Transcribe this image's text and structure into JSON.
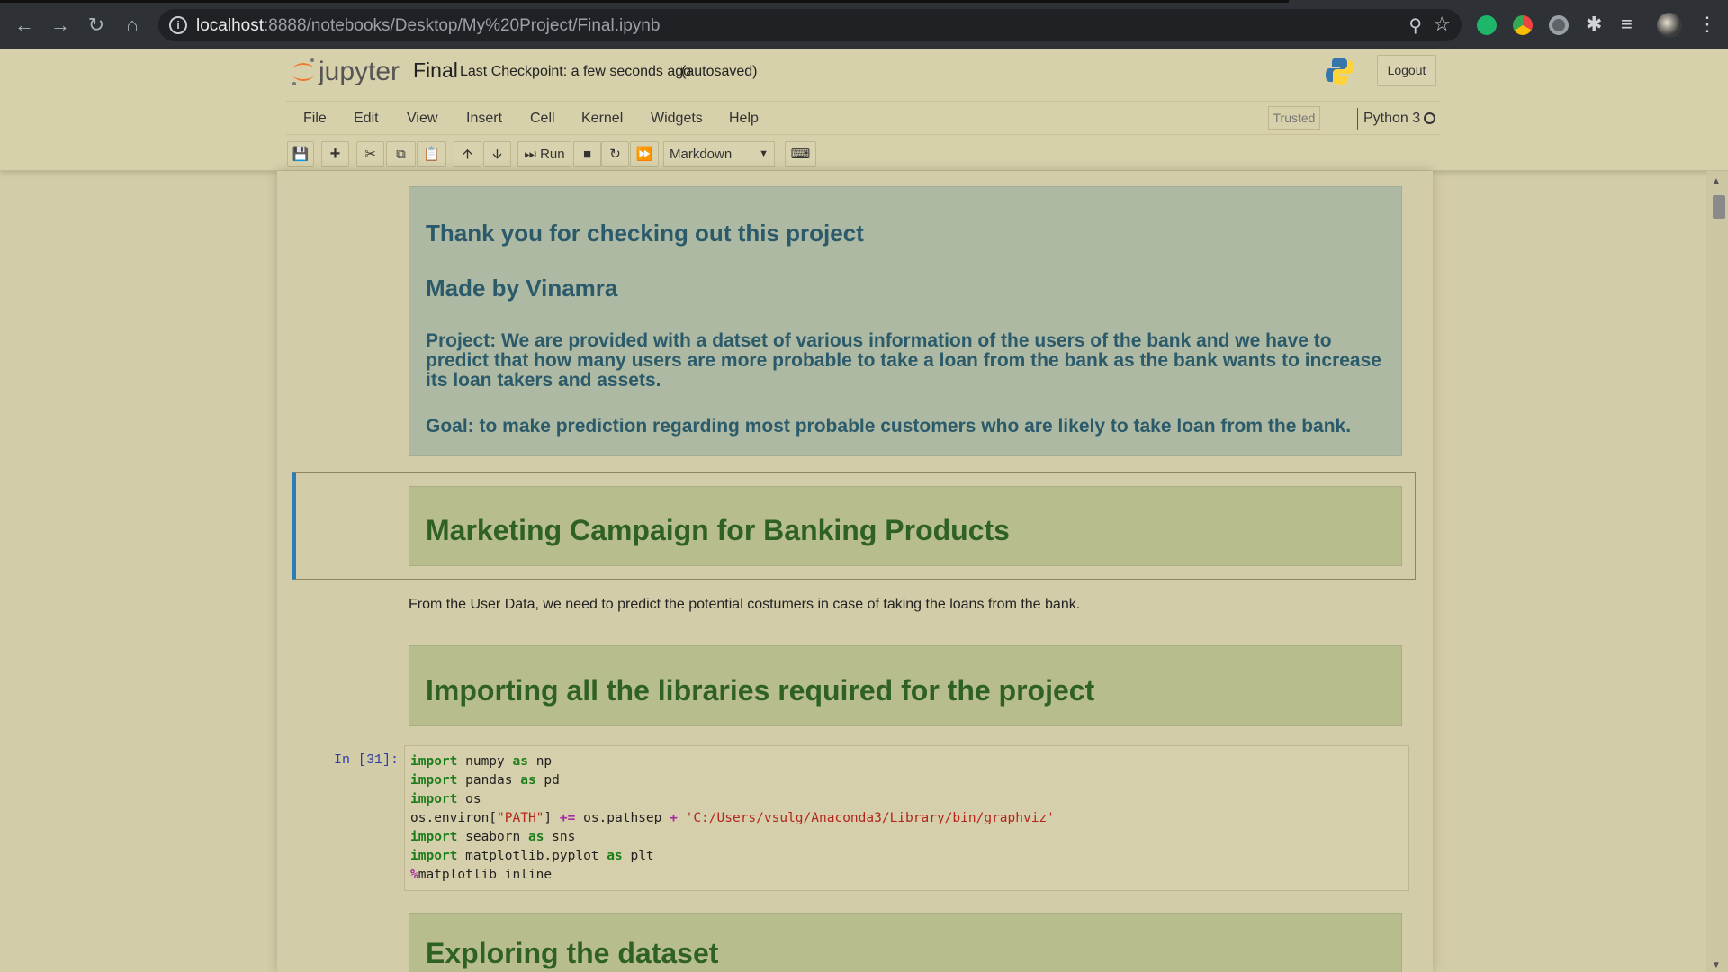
{
  "browser": {
    "url_host": "localhost",
    "url_path": ":8888/notebooks/Desktop/My%20Project/Final.ipynb",
    "back_icon": "arrow-left-icon",
    "forward_icon": "arrow-right-icon",
    "reload_icon": "reload-icon",
    "home_icon": "home-icon"
  },
  "header": {
    "logo_text": "jupyter",
    "notebook_name": "Final",
    "checkpoint": "Last Checkpoint: a few seconds ago",
    "autosaved": "(autosaved)",
    "logout": "Logout"
  },
  "menu": {
    "items": [
      "File",
      "Edit",
      "View",
      "Insert",
      "Cell",
      "Kernel",
      "Widgets",
      "Help"
    ],
    "trusted": "Trusted",
    "kernel": "Python 3"
  },
  "toolbar": {
    "run_label": "Run",
    "cell_type": "Markdown"
  },
  "cells": {
    "thanks_title": "Thank you for checking out this project",
    "made_by": "Made by Vinamra",
    "project": "Project: We are provided with a datset of various information of the users of the bank and we have to predict that how many users are more probable to take a loan from the bank as the bank wants to increase its loan takers and assets.",
    "goal": "Goal: to make prediction regarding most probable customers who are likely to take loan from the bank.",
    "marketing_title": "Marketing Campaign for Banking Products",
    "user_data_text": "From the User Data, we need to predict the potential costumers in case of taking the loans from the bank.",
    "importing_title": "Importing all the libraries required for the project",
    "prompt": "In [31]:",
    "exploring_title": "Exploring the dataset"
  },
  "code": {
    "l1_mod": " numpy ",
    "l1_alias": " np",
    "l2_mod": " pandas ",
    "l2_alias": " pd",
    "l3_mod": " os",
    "l4_a": "os.environ[",
    "l4_key": "\"PATH\"",
    "l4_b": "] ",
    "l4_op1": "+=",
    "l4_c": " os.pathsep ",
    "l4_op2": "+",
    "l4_d": " ",
    "l4_path": "'C:/Users/vsulg/Anaconda3/Library/bin/graphviz'",
    "l5_mod": " seaborn ",
    "l5_alias": " sns",
    "l6_mod": " matplotlib.pyplot ",
    "l6_alias": " plt",
    "l7_pct": "%",
    "l7_rest": "matplotlib inline",
    "kw_import": "import",
    "kw_as": "as"
  }
}
